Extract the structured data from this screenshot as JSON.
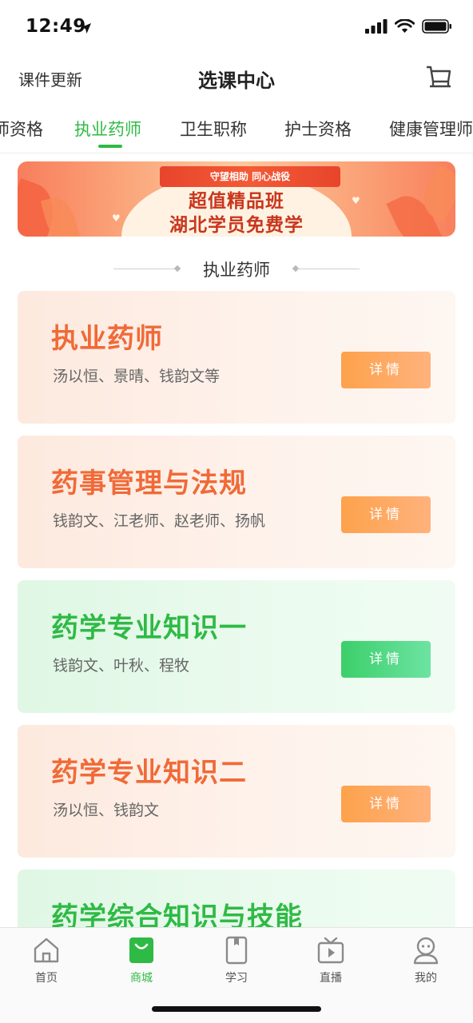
{
  "status_bar": {
    "time": "12:49"
  },
  "header": {
    "left_link": "课件更新",
    "title": "选课中心"
  },
  "tabs": [
    {
      "label": "师资格",
      "active": false
    },
    {
      "label": "执业药师",
      "active": true
    },
    {
      "label": "卫生职称",
      "active": false
    },
    {
      "label": "护士资格",
      "active": false
    },
    {
      "label": "健康管理师",
      "active": false
    }
  ],
  "banner": {
    "ribbon": "守望相助 同心战役",
    "line1": "超值精品班",
    "line2": "湖北学员免费学"
  },
  "section": {
    "title": "执业药师"
  },
  "courses": [
    {
      "title": "执业药师",
      "teachers": "汤以恒、景晴、钱韵文等",
      "button": "详情",
      "theme": "orange"
    },
    {
      "title": "药事管理与法规",
      "teachers": "钱韵文、江老师、赵老师、扬帆",
      "button": "详情",
      "theme": "orange"
    },
    {
      "title": "药学专业知识一",
      "teachers": "钱韵文、叶秋、程牧",
      "button": "详情",
      "theme": "green"
    },
    {
      "title": "药学专业知识二",
      "teachers": "汤以恒、钱韵文",
      "button": "详情",
      "theme": "orange"
    },
    {
      "title": "药学综合知识与技能",
      "theme": "green"
    }
  ],
  "tabbar": [
    {
      "label": "首页",
      "icon": "home-icon",
      "active": false
    },
    {
      "label": "商城",
      "icon": "mall-icon",
      "active": true
    },
    {
      "label": "学习",
      "icon": "book-icon",
      "active": false
    },
    {
      "label": "直播",
      "icon": "tv-icon",
      "active": false
    },
    {
      "label": "我的",
      "icon": "profile-icon",
      "active": false
    }
  ],
  "colors": {
    "accent_green": "#2fba45",
    "accent_orange": "#f06a38",
    "button_orange": "#fda24c",
    "button_green": "#3ccf6a"
  }
}
